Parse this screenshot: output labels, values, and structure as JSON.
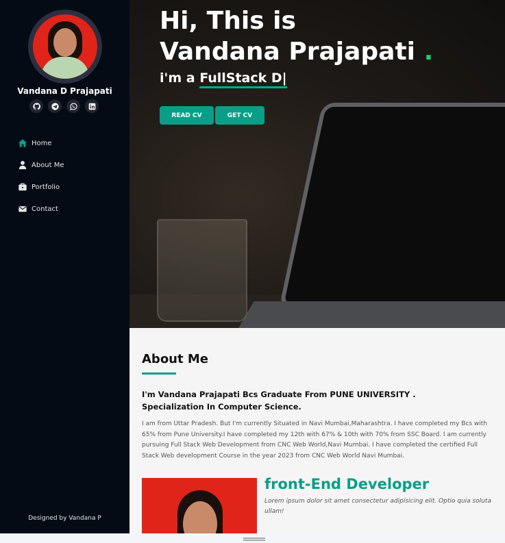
{
  "sidebar": {
    "name": "Vandana D Prajapati",
    "socials": [
      {
        "icon": "github-icon"
      },
      {
        "icon": "telegram-icon"
      },
      {
        "icon": "whatsapp-icon"
      },
      {
        "icon": "linkedin-icon"
      }
    ],
    "nav": [
      {
        "label": "Home",
        "icon": "home-icon"
      },
      {
        "label": "About Me",
        "icon": "user-icon"
      },
      {
        "label": "Portfolio",
        "icon": "briefcase-icon"
      },
      {
        "label": "Contact",
        "icon": "envelope-icon"
      }
    ],
    "credit": "Designed by Vandana P"
  },
  "hero": {
    "line1": "Hi, This is",
    "line2": "Vandana Prajapati",
    "dot": ".",
    "sub_prefix": "i'm a ",
    "sub_typed": "FullStack D|",
    "buttons": {
      "read": "READ CV",
      "get": "GET CV"
    }
  },
  "about": {
    "title": "About Me",
    "lead": "I'm Vandana Prajapati Bcs Graduate From PUNE UNIVERSITY . Specialization In Computer Science.",
    "body": "I am from Uttar Pradesh. But I'm currently Situated in Navi Mumbai,Maharashtra. I have completed my Bcs with 65% from Pune University.I have completed my 12th with 67% & 10th with 70% from SSC Board. I am currently pursuing Full Stack Web Development from CNC Web World,Navi Mumbai. I have completed the certified Full Stack Web development Course in the year 2023 from CNC Web World Navi Mumbai.",
    "role_title": "front-End Developer",
    "role_desc": "Lorem ipsum dolor sit amet consectetur adipisicing elit. Optio quia soluta ullam!"
  },
  "colors": {
    "sidebar_bg": "#040b14",
    "accent": "#0a9e88",
    "hero_dot": "#18d26e"
  }
}
